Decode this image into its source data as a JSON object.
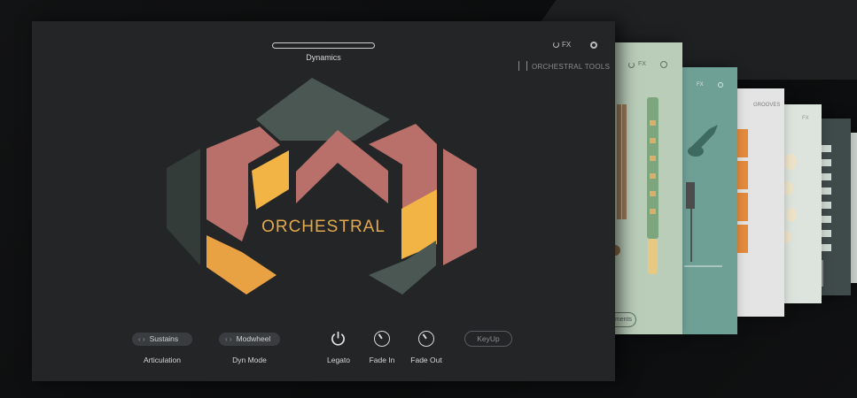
{
  "main": {
    "dynamics_label": "Dynamics",
    "fx_label": "FX",
    "brand": "ORCHESTRAL TOOLS",
    "title": "ORCHESTRAL",
    "articulation": {
      "value": "Sustains",
      "label": "Articulation"
    },
    "dyn_mode": {
      "value": "Modwheel",
      "label": "Dyn Mode"
    },
    "legato_label": "Legato",
    "fade_in_label": "Fade In",
    "fade_out_label": "Fade Out",
    "keyup_label": "KeyUp"
  },
  "cards": {
    "card1_fx": "FX",
    "card1_button": "ments",
    "card2_fx": "FX",
    "card3_label": "GROOVES",
    "card4_fx": "FX"
  },
  "colors": {
    "accent_orange": "#e3a94a",
    "terracotta": "#b9706a",
    "slate": "#4a5753",
    "dark_green": "#343c39",
    "mint_card": "#b9cdb9",
    "teal_card": "#6fa096"
  }
}
